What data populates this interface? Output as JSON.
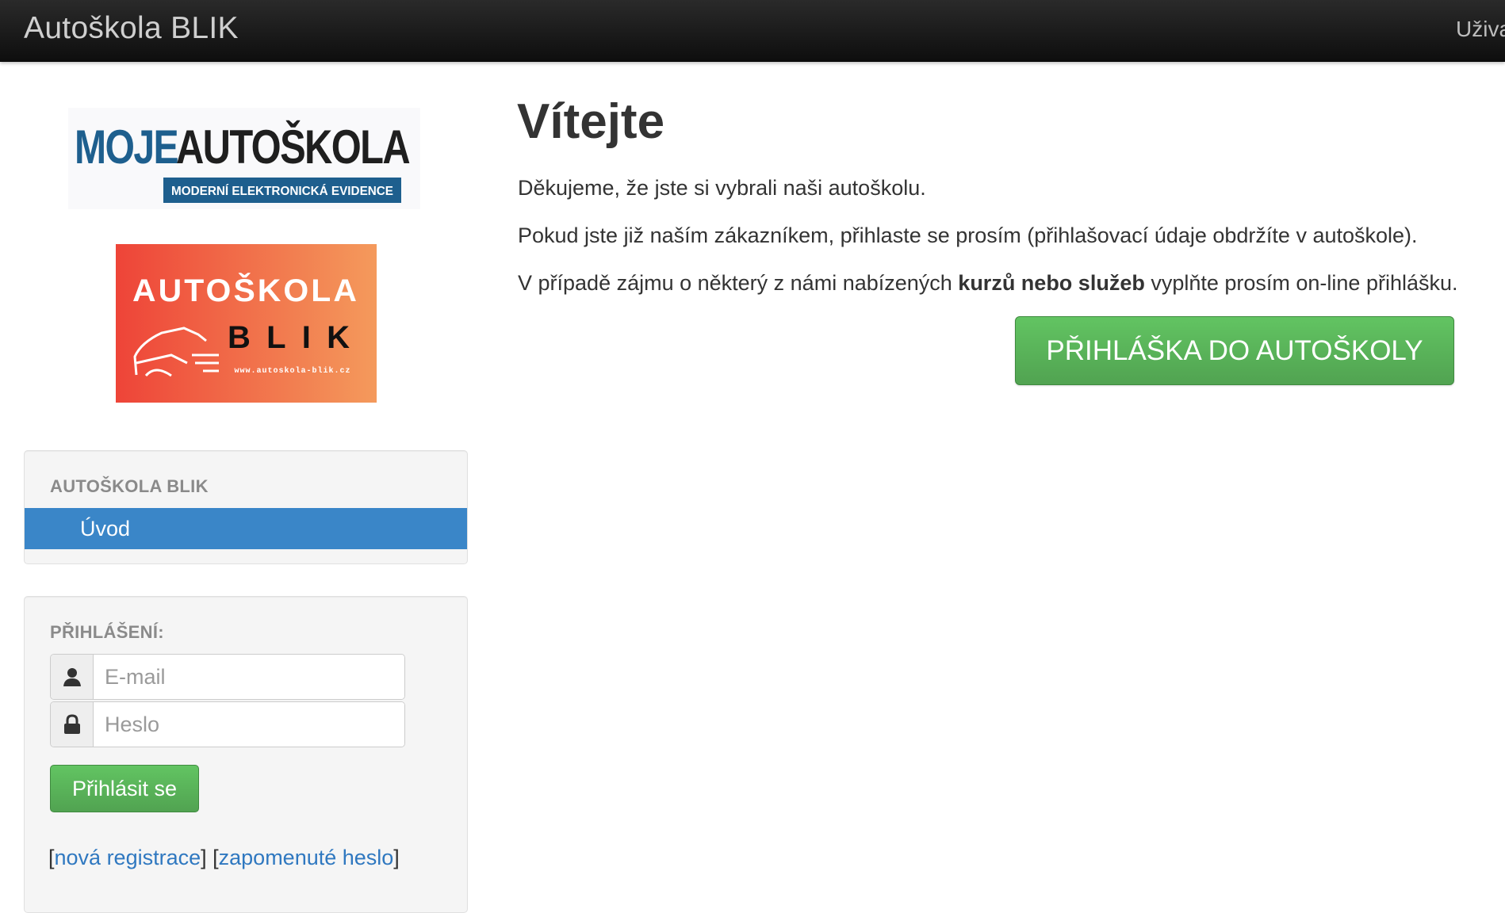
{
  "navbar": {
    "brand": "Autoškola BLIK",
    "user_menu": "Uživa"
  },
  "logos": {
    "moje": {
      "part1": "MOJE",
      "part2": "AUTOŠKOLA",
      "tagline": "MODERNÍ ELEKTRONICKÁ EVIDENCE"
    },
    "blik": {
      "title": "AUTOŠKOLA",
      "subtitle": "BLIK",
      "url": "www.autoskola-blik.cz"
    }
  },
  "sidebar": {
    "nav_header": "AUTOŠKOLA BLIK",
    "items": [
      {
        "label": "Úvod",
        "active": true
      }
    ]
  },
  "login": {
    "header": "PŘIHLÁŠENÍ:",
    "email_placeholder": "E-mail",
    "password_placeholder": "Heslo",
    "submit_label": "Přihlásit se",
    "link_register": "nová registrace",
    "link_forgot": "zapomenuté heslo",
    "bracket_open": "[",
    "bracket_close": "]",
    "bracket_sep": "] ["
  },
  "main": {
    "title": "Vítejte",
    "p1": "Děkujeme, že jste si vybrali naši autoškolu.",
    "p2": "Pokud jste již naším zákazníkem, přihlaste se prosím (přihlašovací údaje obdržíte v autoškole).",
    "p3_before": "V případě zájmu o některý z námi nabízených ",
    "p3_bold": "kurzů nebo služeb",
    "p3_after": " vyplňte prosím on-line přihlášku.",
    "cta_label": "PŘIHLÁŠKA DO AUTOŠKOLY"
  },
  "colors": {
    "navbar_bg": "#1a1a1a",
    "active_nav": "#3a86c8",
    "green_button": "#5bb75b",
    "link": "#2f78c0",
    "moje_blue": "#1e5f8e",
    "blik_red": "#ee4438",
    "blik_orange": "#f49a5c"
  },
  "icons": {
    "email": "user-icon",
    "password": "lock-icon"
  }
}
